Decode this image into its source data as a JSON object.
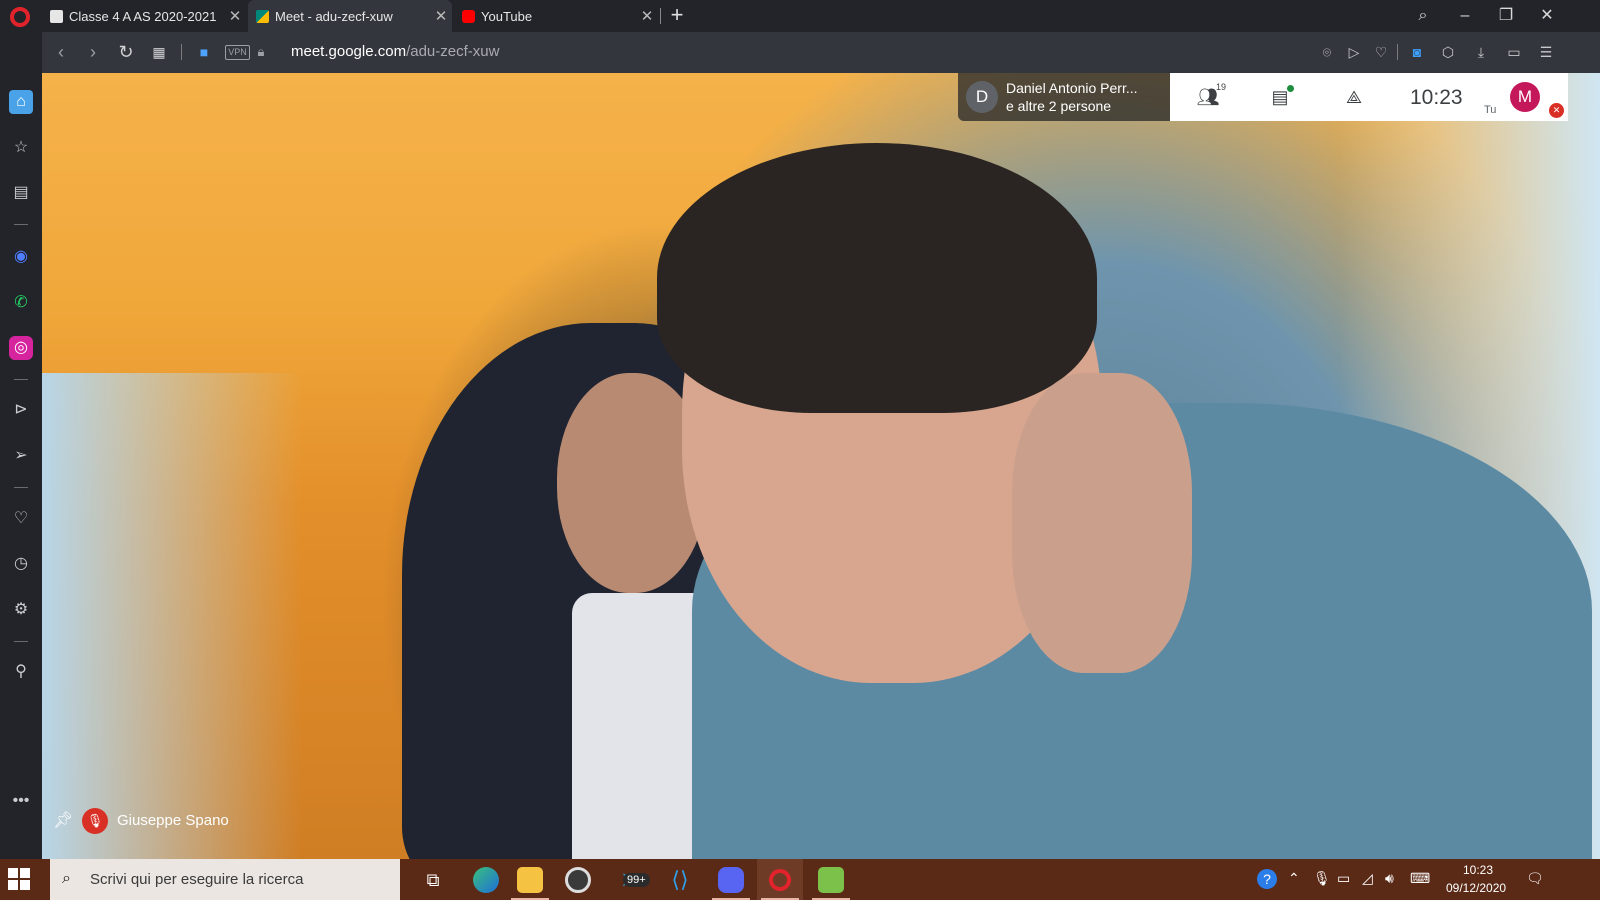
{
  "tabs": [
    {
      "title": "Classe 4 A AS 2020-2021",
      "favicon": "classroom-favicon",
      "color": "#e6e6e6"
    },
    {
      "title": "Meet - adu-zecf-xuw",
      "favicon": "meet-favicon",
      "color": "#00897b"
    },
    {
      "title": "YouTube",
      "favicon": "youtube-favicon",
      "color": "#ff0000"
    }
  ],
  "address": {
    "vpn_label": "VPN",
    "url_host": "meet.google.com",
    "url_path": "/adu-zecf-xuw"
  },
  "meet": {
    "presenter_initial": "D",
    "presenter_line1": "Daniel Antonio Perr...",
    "presenter_line2": "e altre 2 persone",
    "participants_count": "19",
    "time": "10:23",
    "you_label": "Tu",
    "user_initial": "M",
    "speaker_name": "Giuseppe Spano"
  },
  "taskbar": {
    "search_placeholder": "Scrivi qui per eseguire la ricerca",
    "telegram_badge": "99+",
    "clock_time": "10:23",
    "clock_date": "09/12/2020"
  },
  "colors": {
    "accent_opera": "#e2232c",
    "mute_red": "#d93025",
    "avatar_m": "#c5185b",
    "taskbar": "#5a2a17"
  }
}
